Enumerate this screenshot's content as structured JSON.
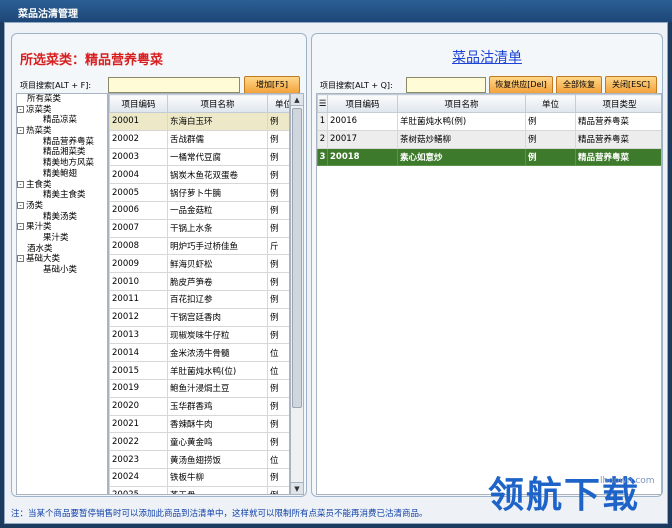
{
  "window": {
    "title": "菜品沽清管理"
  },
  "left": {
    "title": "所选菜类：精品营养粤菜",
    "search_label": "项目搜索[ALT + F]:",
    "search_value": "",
    "add_button": "增加[F5]",
    "tree": [
      {
        "label": "所有菜类",
        "level": 0,
        "box": ""
      },
      {
        "label": "凉菜类",
        "level": 0,
        "box": "-"
      },
      {
        "label": "精品凉菜",
        "level": 2,
        "box": ""
      },
      {
        "label": "热菜类",
        "level": 0,
        "box": "-"
      },
      {
        "label": "精品营养粤菜",
        "level": 2,
        "box": ""
      },
      {
        "label": "精品湘菜类",
        "level": 2,
        "box": ""
      },
      {
        "label": "精美地方风菜",
        "level": 2,
        "box": ""
      },
      {
        "label": "精美鲍翅",
        "level": 2,
        "box": ""
      },
      {
        "label": "主食类",
        "level": 0,
        "box": "-"
      },
      {
        "label": "精美主食类",
        "level": 2,
        "box": ""
      },
      {
        "label": "汤类",
        "level": 0,
        "box": "-"
      },
      {
        "label": "精美汤类",
        "level": 2,
        "box": ""
      },
      {
        "label": "果汁类",
        "level": 0,
        "box": "-"
      },
      {
        "label": "果汁类",
        "level": 2,
        "box": ""
      },
      {
        "label": "酒水类",
        "level": 0,
        "box": ""
      },
      {
        "label": "基础大类",
        "level": 0,
        "box": "-"
      },
      {
        "label": "基础小类",
        "level": 2,
        "box": ""
      }
    ],
    "columns": [
      "项目编码",
      "项目名称",
      "单位"
    ],
    "rows": [
      [
        "20001",
        "东海白玉环",
        "例"
      ],
      [
        "20002",
        "舌战群儒",
        "例"
      ],
      [
        "20003",
        "一桶常代豆腐",
        "例"
      ],
      [
        "20004",
        "锅炭木鱼花双蛋卷",
        "例"
      ],
      [
        "20005",
        "锅仔萝卜牛腩",
        "例"
      ],
      [
        "20006",
        "一品金菇粒",
        "例"
      ],
      [
        "20007",
        "干锅上水条",
        "例"
      ],
      [
        "20008",
        "明炉巧手过桥佳鱼",
        "斤"
      ],
      [
        "20009",
        "鲜海贝虾松",
        "例"
      ],
      [
        "20010",
        "脆皮芦笋卷",
        "例"
      ],
      [
        "20011",
        "百花扣辽参",
        "例"
      ],
      [
        "20012",
        "干锅宫廷香肉",
        "例"
      ],
      [
        "20013",
        "现椒炭味牛仔粒",
        "例"
      ],
      [
        "20014",
        "金米浓汤牛骨髓",
        "位"
      ],
      [
        "20015",
        "羊肚菌炖水鸭(位)",
        "位"
      ],
      [
        "20019",
        "鲍鱼汁浸焗土豆",
        "例"
      ],
      [
        "20020",
        "玉华群香鸡",
        "例"
      ],
      [
        "20021",
        "香辣酥牛肉",
        "例"
      ],
      [
        "20022",
        "童心黄金鸣",
        "例"
      ],
      [
        "20023",
        "黄汤鱼翅捞饭",
        "位"
      ],
      [
        "20024",
        "铁板牛柳",
        "例"
      ],
      [
        "20025",
        "茶王骨",
        "例"
      ]
    ]
  },
  "right": {
    "title": "菜品沽清单",
    "search_label": "项目搜索[ALT + Q]:",
    "search_value": "",
    "buttons": [
      "恢复供应[Del]",
      "全部恢复",
      "关闭[ESC]"
    ],
    "columns": [
      "项目编码",
      "项目名称",
      "单位",
      "项目类型"
    ],
    "rows": [
      [
        "1",
        "20016",
        "羊肚菌炖水鸭(例)",
        "例",
        "精品营养粤菜"
      ],
      [
        "2",
        "20017",
        "茶树菇炒鳝柳",
        "例",
        "精品营养粤菜"
      ],
      [
        "3",
        "20018",
        "素心如意炒",
        "例",
        "精品营养粤菜"
      ]
    ]
  },
  "footer": {
    "note": "注：当某个商品要暂停销售时可以添加此商品到沽清单中，这样就可以限制所有点菜员不能再消费已沽清商品。"
  },
  "watermark": {
    "text": "领航下载",
    "url": "lhdown.com"
  }
}
